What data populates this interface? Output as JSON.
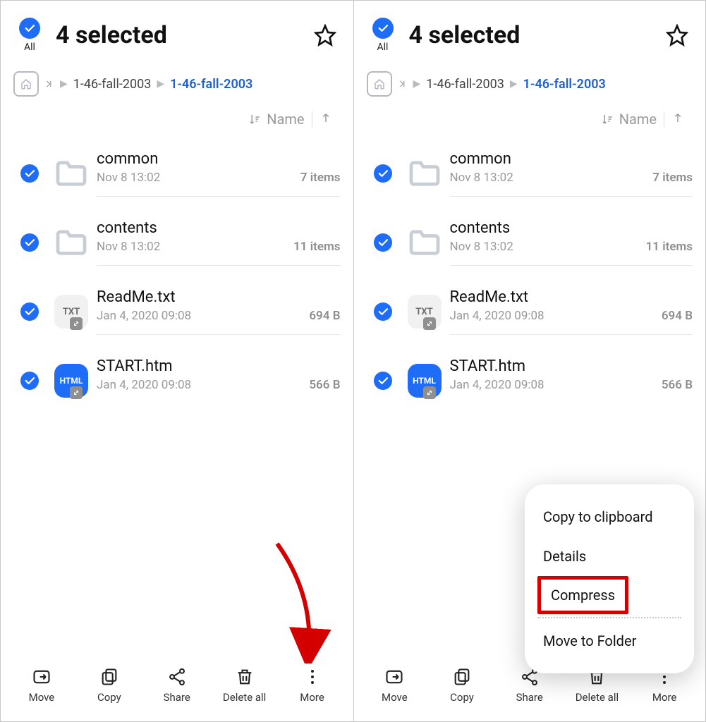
{
  "header": {
    "all_label": "All",
    "title": "4 selected"
  },
  "breadcrumb": {
    "prev": "1-46-fall-2003",
    "current": "1-46-fall-2003"
  },
  "sort": {
    "label": "Name"
  },
  "files": [
    {
      "name": "common",
      "date": "Nov 8 13:02",
      "meta": "7 items",
      "type": "folder"
    },
    {
      "name": "contents",
      "date": "Nov 8 13:02",
      "meta": "11 items",
      "type": "folder"
    },
    {
      "name": "ReadMe.txt",
      "date": "Jan 4, 2020 09:08",
      "meta": "694 B",
      "type": "txt"
    },
    {
      "name": "START.htm",
      "date": "Jan 4, 2020 09:08",
      "meta": "566 B",
      "type": "html"
    }
  ],
  "bottombar": {
    "move": "Move",
    "copy": "Copy",
    "share": "Share",
    "delete": "Delete all",
    "more": "More"
  },
  "menu": {
    "copy_clipboard": "Copy to clipboard",
    "details": "Details",
    "compress": "Compress",
    "move_folder": "Move to Folder"
  },
  "icon_labels": {
    "txt": "TXT",
    "html": "HTML"
  }
}
